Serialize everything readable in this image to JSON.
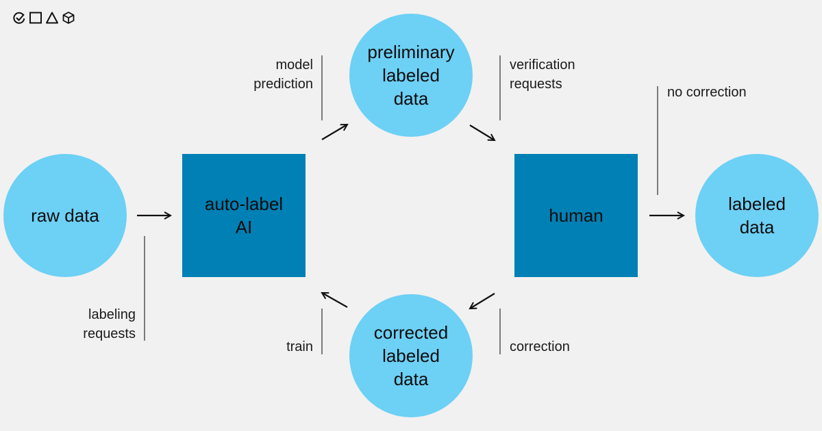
{
  "logo": {
    "icons": [
      "check-circle-icon",
      "square-icon",
      "triangle-icon",
      "cube-icon"
    ]
  },
  "colors": {
    "background": "#f1f1f1",
    "data_circle": "#6dd0f5",
    "process_box": "#0080b4",
    "connector": "#7a7a7a",
    "arrow": "#111111"
  },
  "nodes": {
    "raw_data": "raw data",
    "auto_label_ai": "auto-label\nAI",
    "preliminary_labeled_data": "preliminary\nlabeled\ndata",
    "human": "human",
    "labeled_data": "labeled\ndata",
    "corrected_labeled_data": "corrected\nlabeled\ndata"
  },
  "edges": {
    "labeling_requests": "labeling\nrequests",
    "model_prediction": "model\nprediction",
    "verification_requests": "verification\nrequests",
    "no_correction": "no correction",
    "correction": "correction",
    "train": "train"
  }
}
